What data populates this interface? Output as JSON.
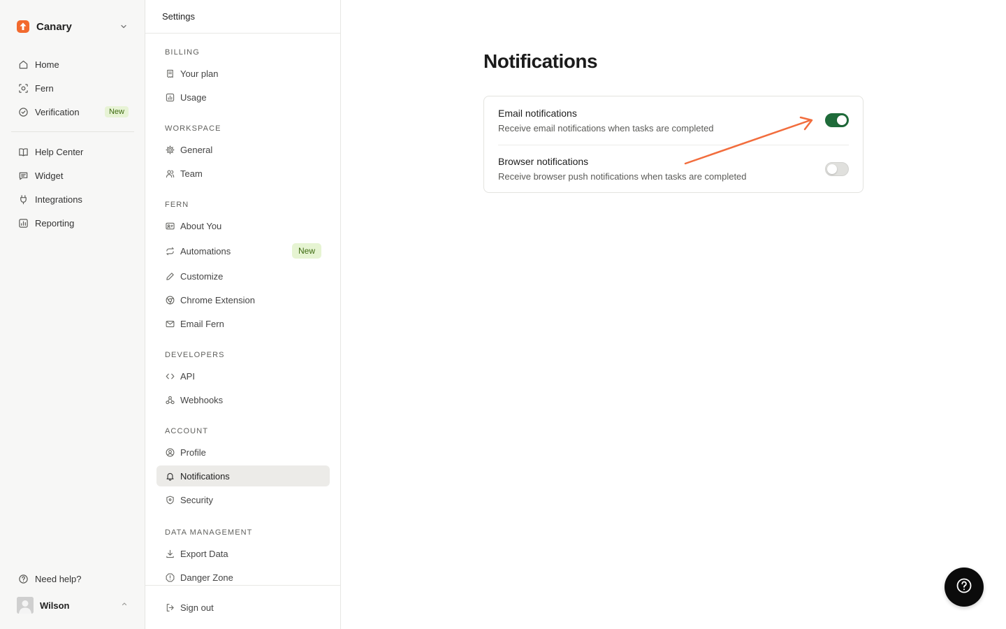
{
  "workspace": {
    "name": "Canary"
  },
  "primary_nav": [
    {
      "label": "Home",
      "icon": "home-icon"
    },
    {
      "label": "Fern",
      "icon": "scan-face-icon"
    },
    {
      "label": "Verification",
      "icon": "check-circle-icon",
      "badge": "New"
    }
  ],
  "secondary_nav": [
    {
      "label": "Help Center",
      "icon": "book-icon"
    },
    {
      "label": "Widget",
      "icon": "message-square-icon"
    },
    {
      "label": "Integrations",
      "icon": "plug-icon"
    },
    {
      "label": "Reporting",
      "icon": "chart-icon"
    }
  ],
  "help": {
    "label": "Need help?"
  },
  "user": {
    "name": "Wilson"
  },
  "settings": {
    "header": "Settings",
    "sections": [
      {
        "title": "BILLING",
        "items": [
          {
            "label": "Your plan"
          },
          {
            "label": "Usage"
          }
        ]
      },
      {
        "title": "WORKSPACE",
        "items": [
          {
            "label": "General"
          },
          {
            "label": "Team"
          }
        ]
      },
      {
        "title": "FERN",
        "items": [
          {
            "label": "About You"
          },
          {
            "label": "Automations",
            "badge": "New"
          },
          {
            "label": "Customize"
          },
          {
            "label": "Chrome Extension"
          },
          {
            "label": "Email Fern"
          }
        ]
      },
      {
        "title": "DEVELOPERS",
        "items": [
          {
            "label": "API"
          },
          {
            "label": "Webhooks"
          }
        ]
      },
      {
        "title": "ACCOUNT",
        "items": [
          {
            "label": "Profile"
          },
          {
            "label": "Notifications"
          },
          {
            "label": "Security"
          }
        ]
      },
      {
        "title": "DATA MANAGEMENT",
        "items": [
          {
            "label": "Export Data"
          },
          {
            "label": "Danger Zone"
          }
        ]
      }
    ],
    "sign_out": "Sign out"
  },
  "page": {
    "title": "Notifications",
    "rows": [
      {
        "title": "Email notifications",
        "description": "Receive email notifications when tasks are completed",
        "enabled": true
      },
      {
        "title": "Browser notifications",
        "description": "Receive browser push notifications when tasks are completed",
        "enabled": false
      }
    ]
  },
  "colors": {
    "brand": "#f26a2e",
    "toggle_on": "#1f6b3a",
    "annotation_arrow": "#f26d3d",
    "active_item_bg": "#ecebe8"
  }
}
